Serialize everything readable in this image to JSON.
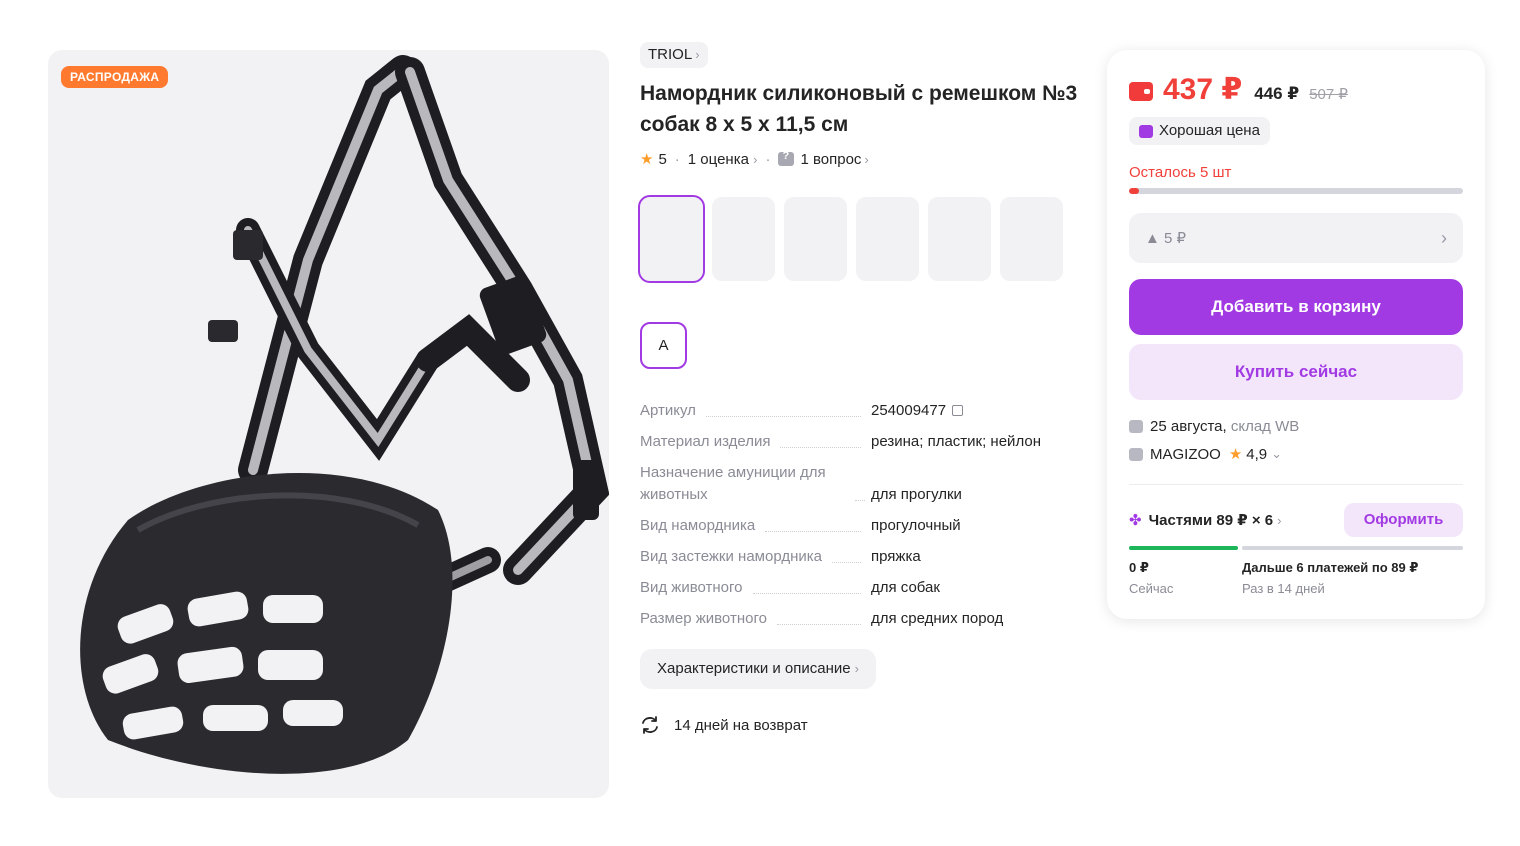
{
  "product": {
    "sale_badge": "РАСПРОДАЖА",
    "brand": "TRIOL",
    "title": "Намордник силиконовый с ремешком №3 собак 8 х 5 х 11,5 см",
    "rating": "5",
    "reviews": "1 оценка",
    "questions": "1 вопрос",
    "size": "A"
  },
  "specs": [
    {
      "key": "Артикул",
      "value": "254009477"
    },
    {
      "key": "Материал изделия",
      "value": "резина; пластик; нейлон"
    },
    {
      "key": "Назначение амуниции для животных",
      "value": "для прогулки"
    },
    {
      "key": "Вид намордника",
      "value": "прогулочный"
    },
    {
      "key": "Вид застежки намордника",
      "value": "пряжка"
    },
    {
      "key": "Вид животного",
      "value": "для собак"
    },
    {
      "key": "Размер животного",
      "value": "для средних пород"
    }
  ],
  "actions": {
    "description_button": "Характеристики и описание",
    "return_text": "14 дней на возврат"
  },
  "buy_card": {
    "price": "437 ₽",
    "price_mid": "446 ₽",
    "price_old": "507 ₽",
    "good_price": "Хорошая цена",
    "stock_left": "Осталось 5 шт",
    "stock_fraction": 0.03,
    "discount_value": "▲ 5 ₽",
    "add_to_cart": "Добавить в корзину",
    "buy_now": "Купить сейчас",
    "delivery_date": "25 августа,",
    "delivery_warehouse": "склад WB",
    "seller_name": "MAGIZOO",
    "seller_rating": "4,9",
    "parts_label": "Частями 89 ₽ × 6",
    "checkout_button": "Оформить",
    "pay_now_value": "0 ₽",
    "pay_now_label": "Сейчас",
    "pay_later_value": "Дальше 6 платежей по 89 ₽",
    "pay_later_label": "Раз в 14 дней"
  },
  "colors": {
    "accent": "#a23ae3",
    "price_red": "#f1403a",
    "sale_orange": "#ff7a2f",
    "green": "#1cb55a"
  }
}
